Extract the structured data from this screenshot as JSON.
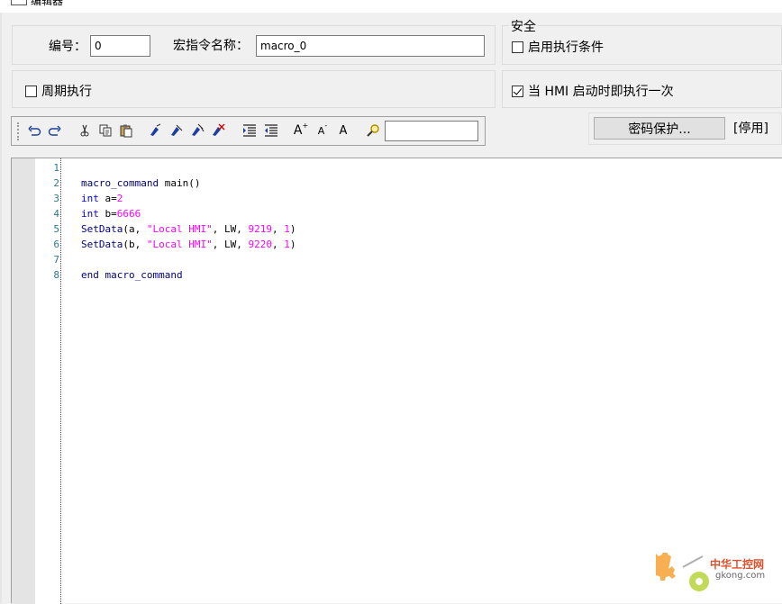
{
  "window": {
    "title": "编辑器"
  },
  "form": {
    "number_label": "编号：",
    "number_value": "0",
    "macro_name_label": "宏指令名称：",
    "macro_name_value": "macro_0",
    "periodic_label": "周期执行",
    "periodic_checked": false
  },
  "security": {
    "group_title": "安全",
    "enable_condition_label": "启用执行条件",
    "enable_condition_checked": false
  },
  "startup": {
    "run_once_label": "当 HMI 启动时即执行一次",
    "run_once_checked": true
  },
  "password": {
    "button_label": "密码保护...",
    "status": "[停用]"
  },
  "toolbar": {
    "buttons": [
      {
        "name": "undo-icon"
      },
      {
        "name": "redo-icon"
      },
      {
        "name": "cut-icon"
      },
      {
        "name": "copy-icon"
      },
      {
        "name": "paste-icon"
      },
      {
        "name": "bookmark-toggle-icon"
      },
      {
        "name": "bookmark-prev-icon"
      },
      {
        "name": "bookmark-next-icon"
      },
      {
        "name": "bookmark-clear-icon"
      },
      {
        "name": "indent-icon"
      },
      {
        "name": "outdent-icon"
      },
      {
        "name": "font-increase-icon"
      },
      {
        "name": "font-decrease-icon"
      },
      {
        "name": "font-reset-icon"
      },
      {
        "name": "find-icon"
      }
    ],
    "font_increase_label": "A",
    "font_decrease_label": "A",
    "font_reset_label": "A",
    "search_value": ""
  },
  "editor": {
    "line_numbers": [
      "1",
      "2",
      "3",
      "4",
      "5",
      "6",
      "7",
      "8"
    ],
    "lines": [
      [],
      [
        {
          "t": "macro_command",
          "c": "fn"
        },
        {
          "t": " main()",
          "c": "plain"
        }
      ],
      [
        {
          "t": "int",
          "c": "kw"
        },
        {
          "t": " a=",
          "c": "plain"
        },
        {
          "t": "2",
          "c": "num"
        }
      ],
      [
        {
          "t": "int",
          "c": "kw"
        },
        {
          "t": " b=",
          "c": "plain"
        },
        {
          "t": "6666",
          "c": "num"
        }
      ],
      [
        {
          "t": "SetData",
          "c": "fn"
        },
        {
          "t": "(a, ",
          "c": "plain"
        },
        {
          "t": "\"Local HMI\"",
          "c": "str"
        },
        {
          "t": ", LW, ",
          "c": "plain"
        },
        {
          "t": "9219",
          "c": "num"
        },
        {
          "t": ", ",
          "c": "plain"
        },
        {
          "t": "1",
          "c": "num"
        },
        {
          "t": ")",
          "c": "plain"
        }
      ],
      [
        {
          "t": "SetData",
          "c": "fn"
        },
        {
          "t": "(b, ",
          "c": "plain"
        },
        {
          "t": "\"Local HMI\"",
          "c": "str"
        },
        {
          "t": ", LW, ",
          "c": "plain"
        },
        {
          "t": "9220",
          "c": "num"
        },
        {
          "t": ", ",
          "c": "plain"
        },
        {
          "t": "1",
          "c": "num"
        },
        {
          "t": ")",
          "c": "plain"
        }
      ],
      [],
      [
        {
          "t": "end",
          "c": "fn"
        },
        {
          "t": " ",
          "c": "plain"
        },
        {
          "t": "macro_command",
          "c": "fn"
        }
      ]
    ]
  },
  "watermark": {
    "brand": "中华工控网",
    "domain": "gkong.com"
  },
  "colors": {
    "keyword": "#0000ff",
    "function": "#000080",
    "literal": "#ff00ff",
    "line_number": "#2a7a8a"
  }
}
